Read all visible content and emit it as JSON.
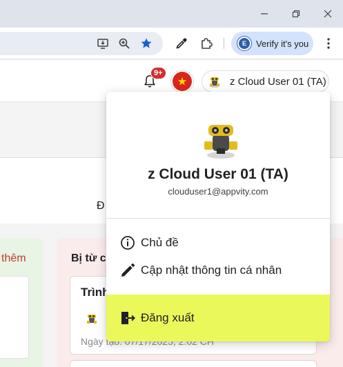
{
  "browser": {
    "verify_label": "Verify it's you",
    "verify_avatar_letter": "E"
  },
  "header": {
    "notifications_badge": "9+",
    "user_chip_name": "z Cloud User 01 (TA)"
  },
  "background": {
    "tab_fragment": "Đ",
    "green_column_title": "thêm",
    "red_column_title": "Bị từ c",
    "card_title": "Trình",
    "card_date": "Ngày tạo: 07/17/2025, 2:02 CH"
  },
  "dropdown": {
    "name": "z Cloud User 01 (TA)",
    "email": "clouduser1@appvity.com",
    "items": [
      {
        "label": "Chủ đề",
        "icon": "info-icon"
      },
      {
        "label": "Cập nhật thông tin cá nhân",
        "icon": "pencil-icon"
      }
    ],
    "logout_label": "Đăng xuất",
    "logout_highlight": "#eaf85a"
  }
}
